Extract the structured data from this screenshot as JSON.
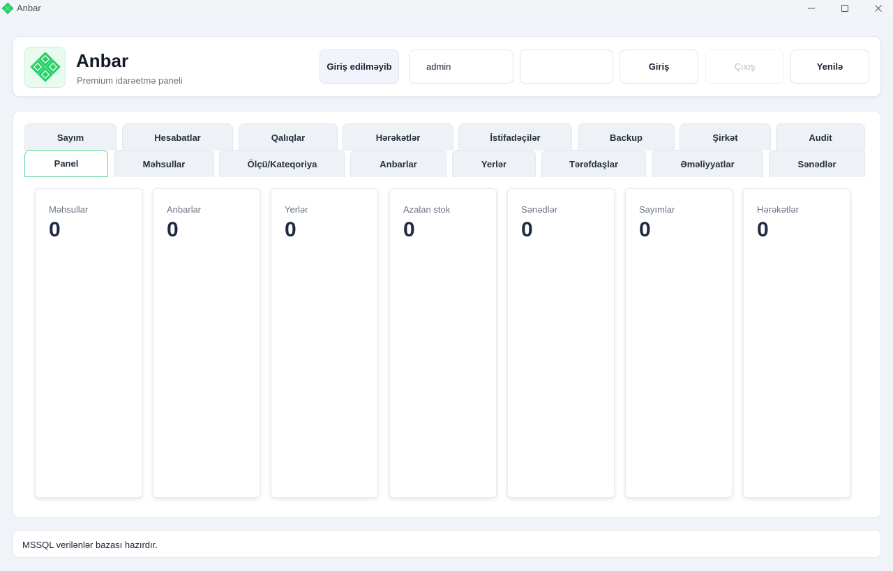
{
  "window": {
    "title": "Anbar",
    "icon": "green-diamond-logo-icon"
  },
  "header": {
    "brand_title": "Anbar",
    "brand_subtitle": "Premium idarəetmə paneli",
    "login_status": "Giriş edilməyib",
    "username_value": "admin",
    "password_value": "",
    "login_button": "Giriş",
    "logout_button": "Çıxış",
    "refresh_button": "Yenilə"
  },
  "tabs_row1": [
    "Sayım",
    "Hesabatlar",
    "Qalıqlar",
    "Hərəkətlər",
    "İstifadəçilər",
    "Backup",
    "Şirkət",
    "Audit"
  ],
  "tabs_row2": [
    "Panel",
    "Məhsullar",
    "Ölçü/Kateqoriya",
    "Anbarlar",
    "Yerlər",
    "Tərəfdaşlar",
    "Əməliyyatlar",
    "Sənədlər"
  ],
  "active_tab": "Panel",
  "stats": [
    {
      "label": "Məhsullar",
      "value": "0"
    },
    {
      "label": "Anbarlar",
      "value": "0"
    },
    {
      "label": "Yerlər",
      "value": "0"
    },
    {
      "label": "Azalan stok",
      "value": "0"
    },
    {
      "label": "Sənədlər",
      "value": "0"
    },
    {
      "label": "Sayımlar",
      "value": "0"
    },
    {
      "label": "Hərəkətlər",
      "value": "0"
    }
  ],
  "status_message": "MSSQL verilənlər bazası hazırdır.",
  "colors": {
    "accent_green": "#2ecc71",
    "active_tab_border": "#5fd59a",
    "background": "#f0f3f8"
  }
}
